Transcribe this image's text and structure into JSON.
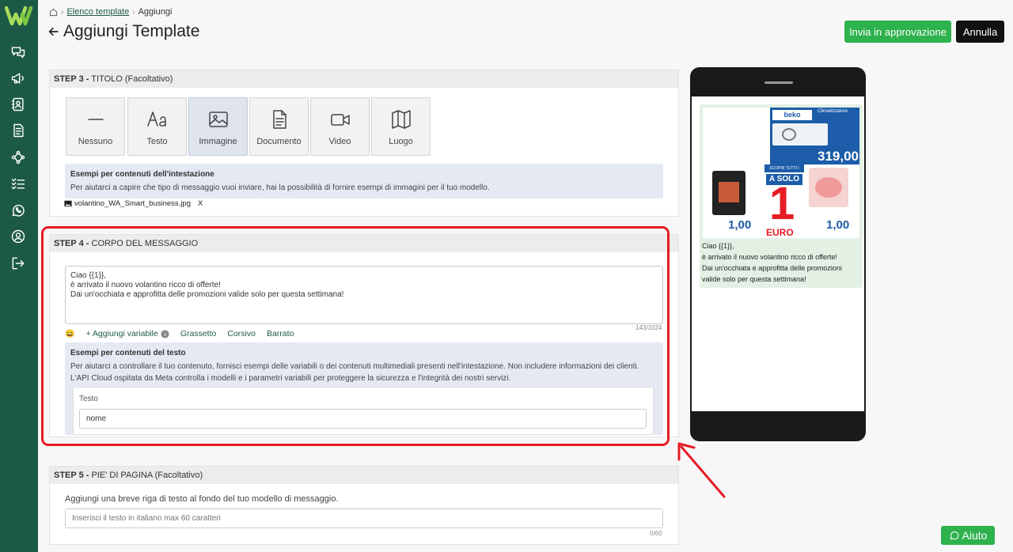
{
  "breadcrumb": {
    "home_icon": "home-icon",
    "link": "Elenco template",
    "current": "Aggiungi"
  },
  "page": {
    "title": "Aggiungi Template"
  },
  "actions": {
    "approve": "Invia in approvazione",
    "cancel": "Annulla",
    "help": "Aiuto"
  },
  "colors": {
    "brand": "#1d5a46",
    "primary": "#2eb24d",
    "highlight": "#e51c24"
  },
  "step3": {
    "header_bold": "STEP 3 -",
    "header": " TITOLO (Facoltativo)",
    "types": [
      "Nessuno",
      "Testo",
      "Immagine",
      "Documento",
      "Video",
      "Luogo"
    ],
    "selected": "Immagine",
    "examples_title": "Esempi per contenuti dell'intestazione",
    "examples_desc": "Per aiutarci a capire che tipo di messaggio vuoi inviare, hai la possibilità di fornire esempi di immagini per il tuo modello.",
    "file_name": "volantino_WA_Smart_business.jpg",
    "remove": "X"
  },
  "step4": {
    "header_bold": "STEP 4 -",
    "header": " CORPO DEL MESSAGGIO",
    "body_text": "Ciao {{1}},\nè arrivato il nuovo volantino ricco di offerte!\nDai un'occhiata e approfitta delle promozioni valide solo per questa settimana!",
    "emoji": "😀",
    "add_variable": "+ Aggiungi variabile",
    "bold": "Grassetto",
    "italic": "Corsivo",
    "strike": "Barrato",
    "counter": "143/1024",
    "examples_title": "Esempi per contenuti del testo",
    "examples_desc": "Per aiutarci a controllare il tuo contenuto, fornisci esempi delle variabili o dei contenuti multimediali presenti nell'intestazione. Non includere informazioni dei clienti. L'API Cloud ospitata da Meta controlla i modelli e i parametri variabili per proteggere la sicurezza e l'integrità dei nostri servizi.",
    "sample_label": "Testo",
    "sample_value": "nome"
  },
  "step5": {
    "header_bold": "STEP 5 -",
    "header": " PIE' DI PAGINA (Facoltativo)",
    "desc": "Aggiungi una breve riga di testo al fondo del tuo modello di messaggio.",
    "placeholder": "Inserisci il testo in italiano max 60 caratteri",
    "counter": "0/60"
  },
  "preview": {
    "message": "Ciao {{1}},\nè arrivato il nuovo volantino ricco di offerte!\nDai un'occhiata e approfitta delle promozioni\nvalide solo per questa settimana!",
    "flyer": {
      "brand": "beko",
      "category": "Climatizzatore",
      "price_main": "319,00",
      "banner": "SCOPRI TUTTI I PRODOTTI",
      "a_solo": "A SOLO",
      "one": "1",
      "euro": "EURO",
      "price_small_1": "1,00",
      "price_small_2": "1,00"
    }
  },
  "sidebar": [
    "chat-icon",
    "megaphone-icon",
    "contacts-icon",
    "template-icon",
    "flow-icon",
    "tasks-icon",
    "whatsapp-icon",
    "profile-icon",
    "logout-icon"
  ]
}
